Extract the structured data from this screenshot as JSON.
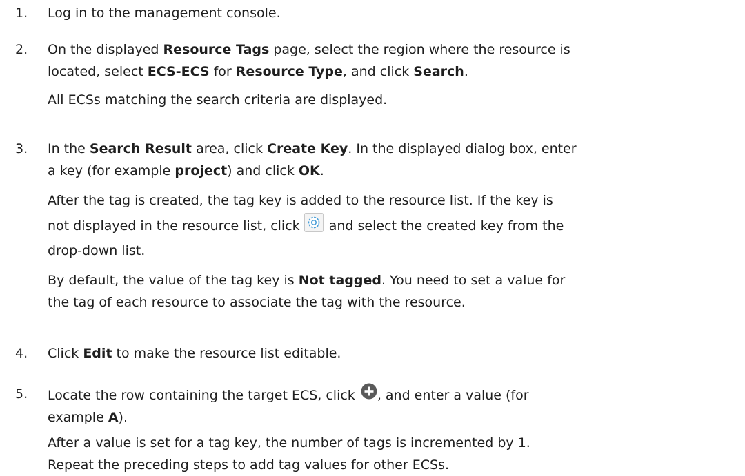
{
  "steps": [
    {
      "number": "1.",
      "text": "Log in to the management console."
    },
    {
      "number": "2.",
      "line1": {
        "a": "On the displayed ",
        "b": "Resource Tags",
        "c": " page, select the region where the resource is"
      },
      "line2": {
        "a": "located, select ",
        "b": "ECS-ECS",
        "c": " for ",
        "d": "Resource Type",
        "e": ", and click ",
        "f": "Search",
        "g": "."
      },
      "note": "All ECSs matching the search criteria are displayed."
    },
    {
      "number": "3.",
      "line1": {
        "a": "In the ",
        "b": "Search Result",
        "c": " area, click ",
        "d": "Create Key",
        "e": ". In the displayed dialog box, enter"
      },
      "line2": {
        "a": "a key (for example ",
        "b": "project",
        "c": ") and click ",
        "d": "OK",
        "e": "."
      },
      "note1": "After the tag is created, the tag key is added to the resource list. If the key is",
      "note2a": "not displayed in the resource list, click",
      "note2b": " and select the created key from the",
      "note3": "drop-down list.",
      "icon": "gear-icon",
      "note4a": "By default, the value of the tag key is ",
      "note4b": "Not tagged",
      "note4c": ". You need to set a value for",
      "note5": "the tag of each resource to associate the tag with the resource."
    },
    {
      "number": "4.",
      "a": "Click ",
      "b": "Edit",
      "c": " to make the resource list editable."
    },
    {
      "number": "5.",
      "line1a": "Locate the row containing the target ECS, click",
      "icon": "add-circle-icon",
      "line1b": ", and enter a value (for",
      "line2a": "example ",
      "line2b": "A",
      "line2c": ").",
      "note1": "After a value is set for a tag key, the number of tags is incremented by 1.",
      "note2": "Repeat the preceding steps to add tag values for other ECSs."
    }
  ],
  "colors": {
    "text": "#1f1f1f",
    "gear_icon_border": "#c8c8c8",
    "gear_icon_fill": "#f4f4f4",
    "gear_icon_accent": "#4a9fd8",
    "add_icon_fill": "#5a5a5a"
  }
}
